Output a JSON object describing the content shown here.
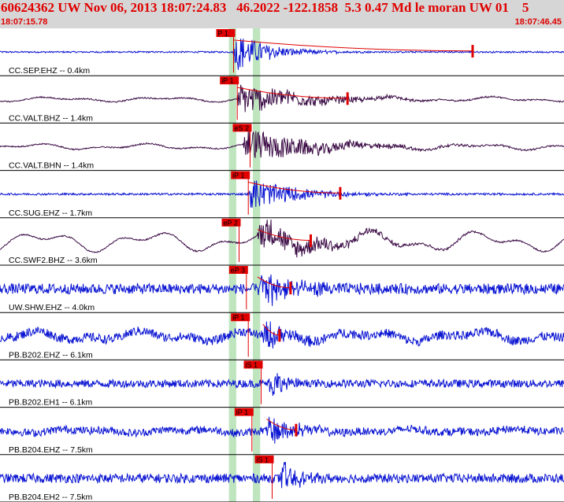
{
  "header": {
    "title": "60624362 UW Nov 06, 2013 18:07:24.83   46.2022 -122.1858  5.3 0.47 Md le moran UW 01    5",
    "start_time": "18:07:15.78",
    "end_time": "18:07:46.45"
  },
  "colors": {
    "header_bg": "#d6d6d6",
    "header_text": "#e00000",
    "trace_blue": "#0a14d2",
    "trace_dark": "#3a0a44",
    "pick_red": "#e00000",
    "highlight_green": "#bfe5bf"
  },
  "chart_data": {
    "type": "line",
    "x_unit": "time",
    "x_range": [
      "18:07:15.78",
      "18:07:46.45"
    ],
    "highlight_bands_s": [
      [
        12.45,
        12.85
      ],
      [
        13.75,
        14.15
      ]
    ],
    "traces": [
      {
        "label": "CC.SEP.EHZ -- 0.4km",
        "color": "blue",
        "picks": [
          {
            "label": "P 1",
            "t": 12.7
          }
        ],
        "noise": 0.06,
        "lp": 0,
        "amp": 1.0,
        "onset": 12.7,
        "decay": 1.8,
        "coda_end": 25.7
      },
      {
        "label": "CC.VALT.BHZ -- 1.4km",
        "color": "dark",
        "picks": [
          {
            "label": "iP 1",
            "t": 12.9
          }
        ],
        "noise": 0.05,
        "lp": 0.12,
        "amp": 0.8,
        "onset": 12.9,
        "decay": 3.5,
        "coda_end": 18.9
      },
      {
        "label": "CC.VALT.BHN -- 1.4km",
        "color": "dark",
        "picks": [
          {
            "label": "eS 2",
            "t": 13.6
          }
        ],
        "noise": 0.05,
        "lp": 0.15,
        "amp": 0.8,
        "onset": 13.2,
        "decay": 4.0,
        "coda_end": null
      },
      {
        "label": "CC.SUG.EHZ -- 1.7km",
        "color": "blue",
        "picks": [
          {
            "label": "iP 1",
            "t": 13.5
          }
        ],
        "noise": 0.08,
        "lp": 0,
        "amp": 0.8,
        "onset": 13.5,
        "decay": 2.5,
        "coda_end": 18.5
      },
      {
        "label": "CC.SWF2.BHZ -- 3.6km",
        "color": "dark",
        "picks": [
          {
            "label": "eP 2",
            "t": 13.0
          }
        ],
        "noise": 0.05,
        "lp": 0.5,
        "amp": 0.8,
        "onset": 14.0,
        "decay": 3.5,
        "coda_end": 16.9
      },
      {
        "label": "UW.SHW.EHZ -- 4.0km",
        "color": "blue",
        "picks": [
          {
            "label": "eP 3",
            "t": 13.4
          }
        ],
        "noise": 0.4,
        "lp": 0,
        "amp": 0.9,
        "onset": 14.0,
        "decay": 2.0,
        "coda_end": 15.8
      },
      {
        "label": "PB.B202.EHZ -- 6.1km",
        "color": "blue",
        "picks": [
          {
            "label": "iP 1",
            "t": 13.5
          }
        ],
        "noise": 0.35,
        "lp": 0.25,
        "amp": 0.8,
        "onset": 14.3,
        "decay": 1.2,
        "coda_end": 15.2
      },
      {
        "label": "PB.B202.EH1 -- 6.1km",
        "color": "blue",
        "picks": [
          {
            "label": "iS 1",
            "t": 14.2
          }
        ],
        "noise": 0.3,
        "lp": 0,
        "amp": 0.9,
        "onset": 14.6,
        "decay": 0.7,
        "coda_end": null
      },
      {
        "label": "PB.B204.EHZ -- 7.5km",
        "color": "blue",
        "picks": [
          {
            "label": "iP 1",
            "t": 13.7
          }
        ],
        "noise": 0.3,
        "lp": 0.1,
        "amp": 0.85,
        "onset": 14.5,
        "decay": 1.2,
        "coda_end": 16.1
      },
      {
        "label": "PB.B204.EH2 -- 7.5km",
        "color": "blue",
        "picks": [
          {
            "label": "iS 1",
            "t": 14.8
          }
        ],
        "noise": 0.35,
        "lp": 0,
        "amp": 0.9,
        "onset": 15.2,
        "decay": 0.9,
        "coda_end": null
      }
    ]
  }
}
